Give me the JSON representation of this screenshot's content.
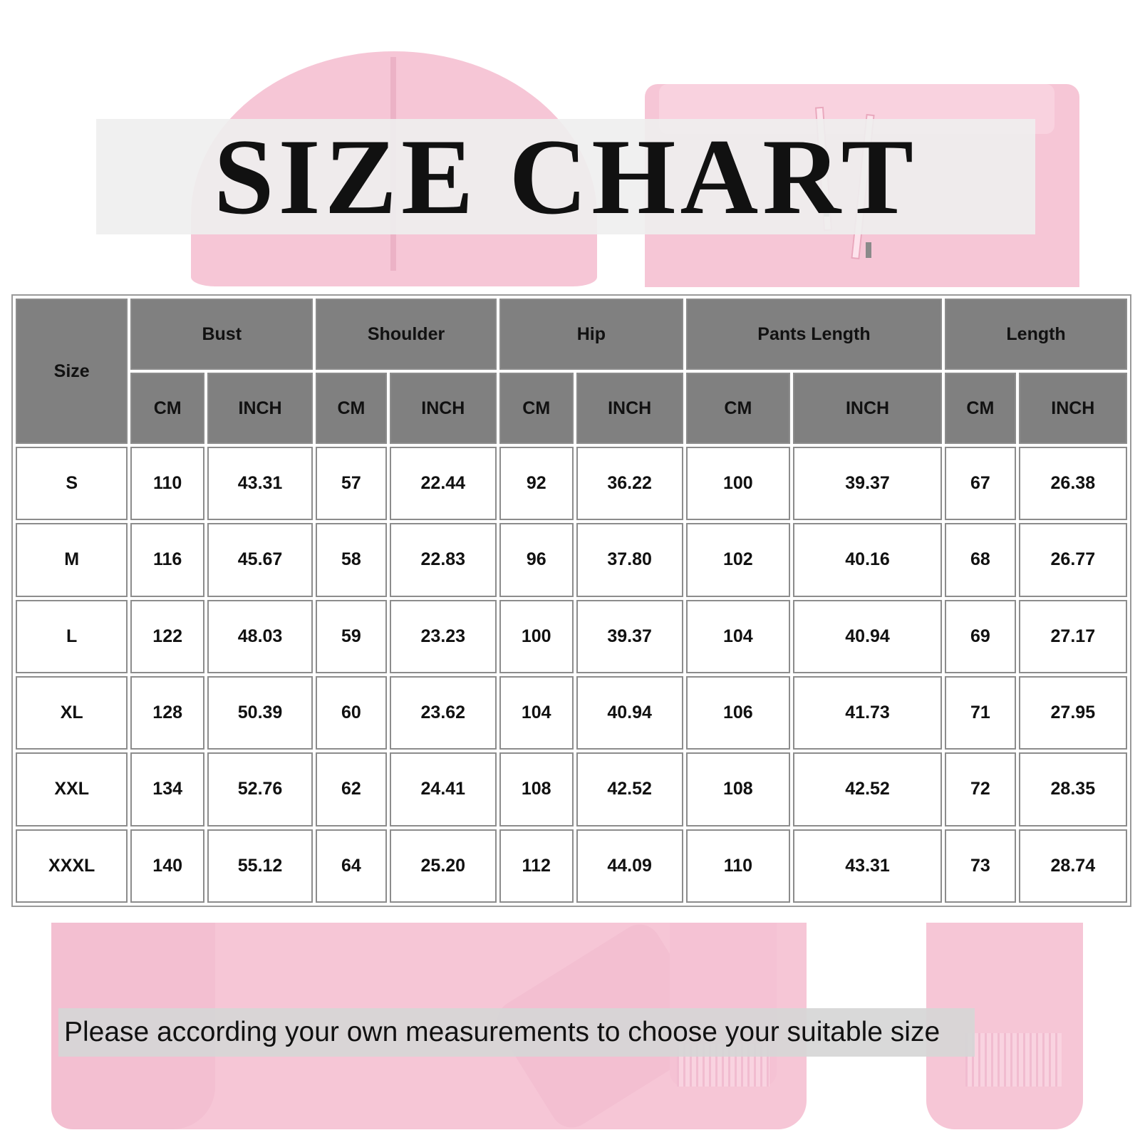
{
  "title": "SIZE CHART",
  "table": {
    "size_header": "Size",
    "groups": [
      {
        "label": "Bust",
        "cm": "CM",
        "inch": "INCH"
      },
      {
        "label": "Shoulder",
        "cm": "CM",
        "inch": "INCH"
      },
      {
        "label": "Hip",
        "cm": "CM",
        "inch": "INCH"
      },
      {
        "label": "Pants Length",
        "cm": "CM",
        "inch": "INCH"
      },
      {
        "label": "Length",
        "cm": "CM",
        "inch": "INCH"
      }
    ],
    "rows": [
      [
        "S",
        "110",
        "43.31",
        "57",
        "22.44",
        "92",
        "36.22",
        "100",
        "39.37",
        "67",
        "26.38"
      ],
      [
        "M",
        "116",
        "45.67",
        "58",
        "22.83",
        "96",
        "37.80",
        "102",
        "40.16",
        "68",
        "26.77"
      ],
      [
        "L",
        "122",
        "48.03",
        "59",
        "23.23",
        "100",
        "39.37",
        "104",
        "40.94",
        "69",
        "27.17"
      ],
      [
        "XL",
        "128",
        "50.39",
        "60",
        "23.62",
        "104",
        "40.94",
        "106",
        "41.73",
        "71",
        "27.95"
      ],
      [
        "XXL",
        "134",
        "52.76",
        "62",
        "24.41",
        "108",
        "42.52",
        "108",
        "42.52",
        "72",
        "28.35"
      ],
      [
        "XXXL",
        "140",
        "55.12",
        "64",
        "25.20",
        "112",
        "44.09",
        "110",
        "43.31",
        "73",
        "28.74"
      ]
    ]
  },
  "note": "Please according your own measurements to choose your suitable size",
  "colors": {
    "garment_pink": "#f6c6d6",
    "header_gray": "#808080",
    "title_band": "#eeeeee",
    "note_band": "#d6d6d6"
  }
}
